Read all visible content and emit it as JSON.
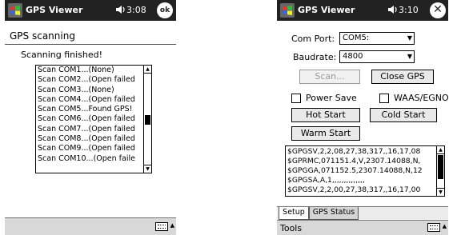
{
  "left": {
    "title": "GPS Viewer",
    "time": "3:08",
    "ok_label": "ok",
    "section_title": "GPS scanning",
    "status": "Scanning finished!",
    "scan_results": [
      "Scan COM1...(None)",
      "Scan COM2...(Open failed",
      "Scan COM3...(None)",
      "Scan COM4...(Open failed",
      "Scan COM5...Found GPS!",
      "Scan COM6...(Open failed",
      "Scan COM7...(Open failed",
      "Scan COM8...(Open failed",
      "Scan COM9...(Open failed",
      "Scan COM10...(Open faile"
    ],
    "scroll_position": 0.5
  },
  "right": {
    "title": "GPS Viewer",
    "time": "3:10",
    "com_port_label": "Com Port:",
    "com_port_value": "COM5:",
    "baudrate_label": "Baudrate:",
    "baudrate_value": "4800",
    "scan_button": "Scan...",
    "close_gps_button": "Close GPS",
    "power_save_label": "Power Save",
    "power_save_checked": false,
    "waas_label": "WAAS/EGNOS",
    "waas_checked": false,
    "hot_start_button": "Hot Start",
    "cold_start_button": "Cold Start",
    "warm_start_button": "Warm Start",
    "nmea_lines": [
      "$GPGSV,2,2,08,27,38,317,,16,17,08",
      "$GPRMC,071151.4,V,2307.14088,N,",
      "$GPGGA,071152.5,2307.14088,N,12",
      "$GPGSA,A,1,,,,,,,,,,,,,,",
      "$GPGSV,2,2,00,27,38,317,,16,17,00"
    ],
    "tabs": [
      "Setup",
      "GPS Status"
    ],
    "active_tab": "Setup",
    "menu_tools": "Tools"
  },
  "icons": {
    "windows_logo": "windows-flag-icon",
    "speaker": "speaker-icon",
    "keyboard": "keyboard-icon"
  }
}
